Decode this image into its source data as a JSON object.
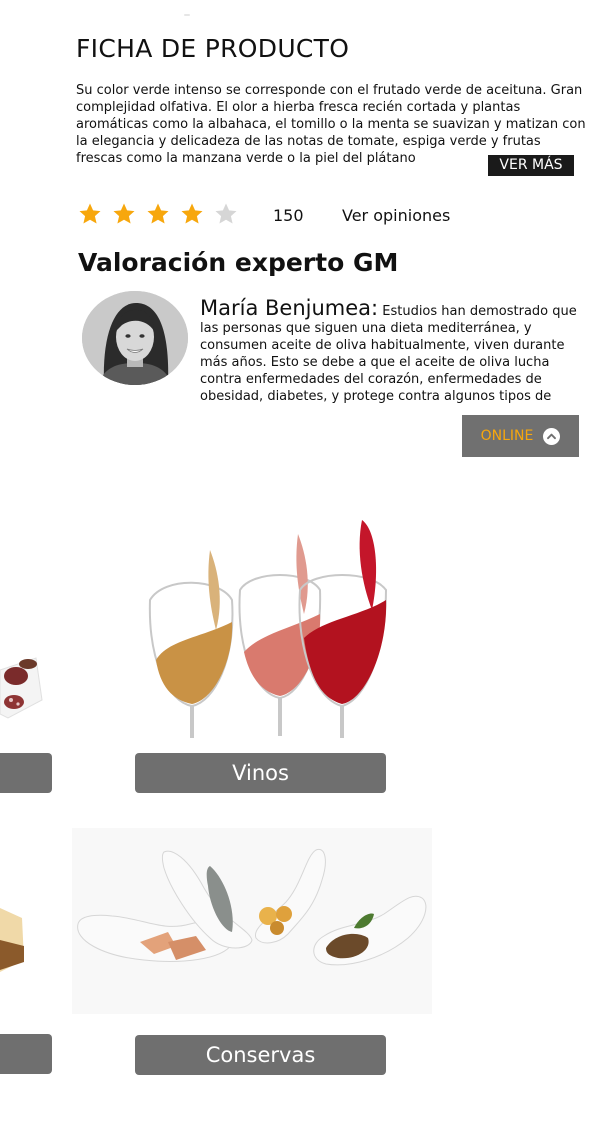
{
  "product": {
    "title": "FICHA DE PRODUCTO",
    "description": "Su color verde intenso se corresponde con el frutado verde de aceituna. Gran complejidad olfativa. El olor a hierba fresca recién cortada y plantas aromáticas como la albahaca, el tomillo o la menta se suavizan y matizan con la elegancia y delicadeza de las notas de tomate, espiga verde y frutas frescas como la manzana verde o la piel del plátano",
    "ver_mas_label": "VER MÁS"
  },
  "rating": {
    "stars": 4,
    "max_stars": 5,
    "count": "150",
    "ver_opiniones_label": "Ver opiniones",
    "star_color": "#f7a70d",
    "star_empty_color": "#d6d6d6"
  },
  "expert": {
    "section_title": "Valoración experto GM",
    "name": "María Benjumea:",
    "text": "Estudios han demostrado que las personas que siguen una dieta mediterránea, y consumen aceite de oliva habitualmente, viven durante más años. Esto se debe a que el aceite de oliva lucha contra enfermedades del corazón, enfermedades de obesidad, diabetes, y protege contra algunos tipos de"
  },
  "online_button": {
    "label": "ONLINE",
    "icon": "chevron-up-icon",
    "label_color": "#f7a70d"
  },
  "categories": [
    {
      "label": "Vinos"
    },
    {
      "label": "Conservas"
    }
  ]
}
